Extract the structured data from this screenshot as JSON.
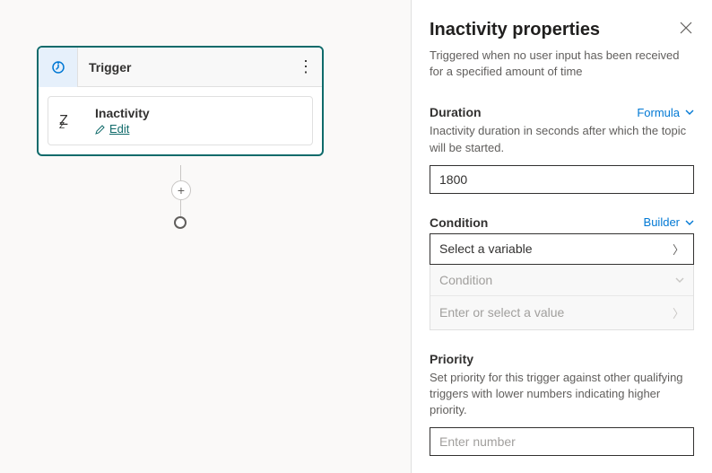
{
  "canvas": {
    "trigger": {
      "header_label": "Trigger",
      "inner_title": "Inactivity",
      "edit_label": "Edit"
    }
  },
  "panel": {
    "title": "Inactivity properties",
    "subtitle": "Triggered when no user input has been received for a specified amount of time",
    "duration": {
      "label": "Duration",
      "action": "Formula",
      "desc": "Inactivity duration in seconds after which the topic will be started.",
      "value": "1800"
    },
    "condition": {
      "label": "Condition",
      "action": "Builder",
      "select_placeholder": "Select a variable",
      "row1": "Condition",
      "row2": "Enter or select a value"
    },
    "priority": {
      "label": "Priority",
      "desc": "Set priority for this trigger against other qualifying triggers with lower numbers indicating higher priority.",
      "placeholder": "Enter number"
    }
  }
}
